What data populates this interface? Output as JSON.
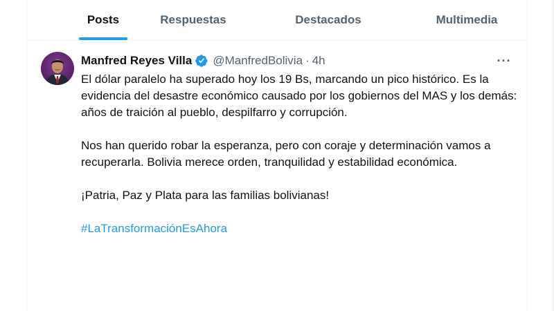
{
  "tabs": [
    {
      "label": "Posts",
      "active": true
    },
    {
      "label": "Respuestas",
      "active": false
    },
    {
      "label": "Destacados",
      "active": false
    },
    {
      "label": "Multimedia",
      "active": false
    }
  ],
  "tweet": {
    "author_name": "Manfred Reyes Villa",
    "verified": true,
    "handle": "@ManfredBolivia",
    "separator": "·",
    "time": "4h",
    "more_label": "···",
    "paragraphs": [
      "El dólar paralelo ha superado hoy los 19 Bs, marcando un pico histórico. Es la evidencia del desastre económico causado por los gobiernos del MAS y los demás: años de traición al pueblo, despilfarro y corrupción.",
      "Nos han querido robar la esperanza, pero con coraje y determinación vamos a recuperarla. Bolivia merece orden, tranquilidad y estabilidad económica.",
      "¡Patria, Paz y Plata para las familias bolivianas!"
    ],
    "hashtag": "#LaTransformaciónEsAhora"
  },
  "colors": {
    "accent": "#1d9bf0",
    "text": "#0f1419",
    "muted": "#536471",
    "border": "#eff3f4"
  },
  "icons": {
    "verified": "verified-badge-icon",
    "more": "more-options-icon"
  }
}
